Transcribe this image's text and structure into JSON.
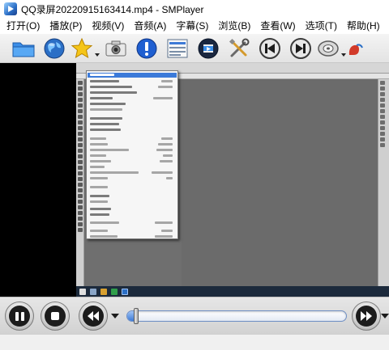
{
  "window": {
    "title": "QQ录屏20220915163414.mp4 - SMPlayer",
    "app_icon": "smplayer-icon"
  },
  "menubar": {
    "items": [
      {
        "label": "打开(O)"
      },
      {
        "label": "播放(P)"
      },
      {
        "label": "视频(V)"
      },
      {
        "label": "音频(A)"
      },
      {
        "label": "字幕(S)"
      },
      {
        "label": "浏览(B)"
      },
      {
        "label": "查看(W)"
      },
      {
        "label": "选项(T)"
      },
      {
        "label": "帮助(H)"
      }
    ]
  },
  "toolbar": {
    "buttons": [
      {
        "icon": "folder-icon",
        "name": "open-file-button"
      },
      {
        "icon": "globe-icon",
        "name": "open-url-button"
      },
      {
        "icon": "star-icon",
        "name": "favorites-button",
        "has_dropdown": true
      },
      {
        "icon": "camera-icon",
        "name": "screenshot-button"
      },
      {
        "icon": "info-icon",
        "name": "info-button"
      },
      {
        "icon": "playlist-icon",
        "name": "playlist-button"
      },
      {
        "icon": "film-icon",
        "name": "video-equalizer-button"
      },
      {
        "icon": "tools-icon",
        "name": "preferences-button"
      },
      {
        "icon": "skip-back-icon",
        "name": "previous-button"
      },
      {
        "icon": "skip-forward-icon",
        "name": "next-button"
      },
      {
        "icon": "disc-icon",
        "name": "disc-button",
        "has_dropdown": true
      },
      {
        "icon": "subtitle-icon",
        "name": "subtitle-button"
      }
    ],
    "colors": {
      "accent_blue": "#2b6fc6",
      "star": "#f5c518",
      "info": "#1f5fd1",
      "subtitle": "#d23a2a"
    }
  },
  "controls": {
    "progress": 0.045,
    "colors": {
      "seek_fill": "#3d7ad6",
      "button_dark": "#1c1c1c"
    }
  }
}
